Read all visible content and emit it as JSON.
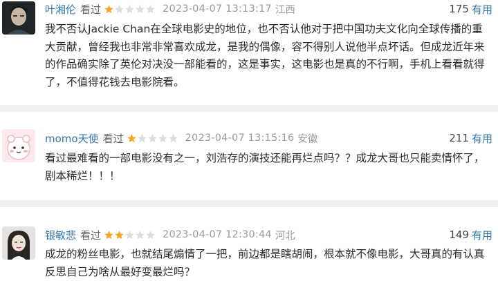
{
  "comments": [
    {
      "username": "叶湘伦",
      "watched": "看过",
      "rating": 1,
      "time": "2023-04-07 13:13:17",
      "location": "江西",
      "votes": "175",
      "helpful": "有用",
      "avatar_icon": "dark-portrait-avatar",
      "content": "我不否认Jackie Chan在全球电影史的地位，也不否认他对于把中国功夫文化向全球传播的重大贡献，曾经我也非常非常喜欢成龙，是我的偶像，容不得别人说他半点坏话。但成龙近年来的作品确实除了英伦对决没一部能看的，这是事实，这电影也是真的不行啊，手机上看看就得了，不值得花钱去电影院看。"
    },
    {
      "username": "momo天使",
      "watched": "看过",
      "rating": 1,
      "time": "2023-04-07 13:15:16",
      "location": "安徽",
      "votes": "211",
      "helpful": "有用",
      "avatar_icon": "pink-cartoon-avatar",
      "content": "看过最难看的一部电影没有之一，刘浩存的演技还能再烂点吗？？成龙大哥也只能卖情怀了，剧本稀烂！！！"
    },
    {
      "username": "银敏悲",
      "watched": "看过",
      "rating": 2,
      "time": "2023-04-07 12:30:44",
      "location": "河北",
      "votes": "149",
      "helpful": "有用",
      "avatar_icon": "girl-portrait-avatar",
      "content": "成龙的粉丝电影，也就结尾煽情了一把，前边都是瞎胡闹，根本就不像电影，大哥真的有认真反思自己为啥从最好变最烂吗？"
    }
  ],
  "colors": {
    "username": "#3377aa",
    "star_filled": "#f5a623",
    "star_empty": "#dddddd",
    "divider": "#f0f0f0"
  }
}
